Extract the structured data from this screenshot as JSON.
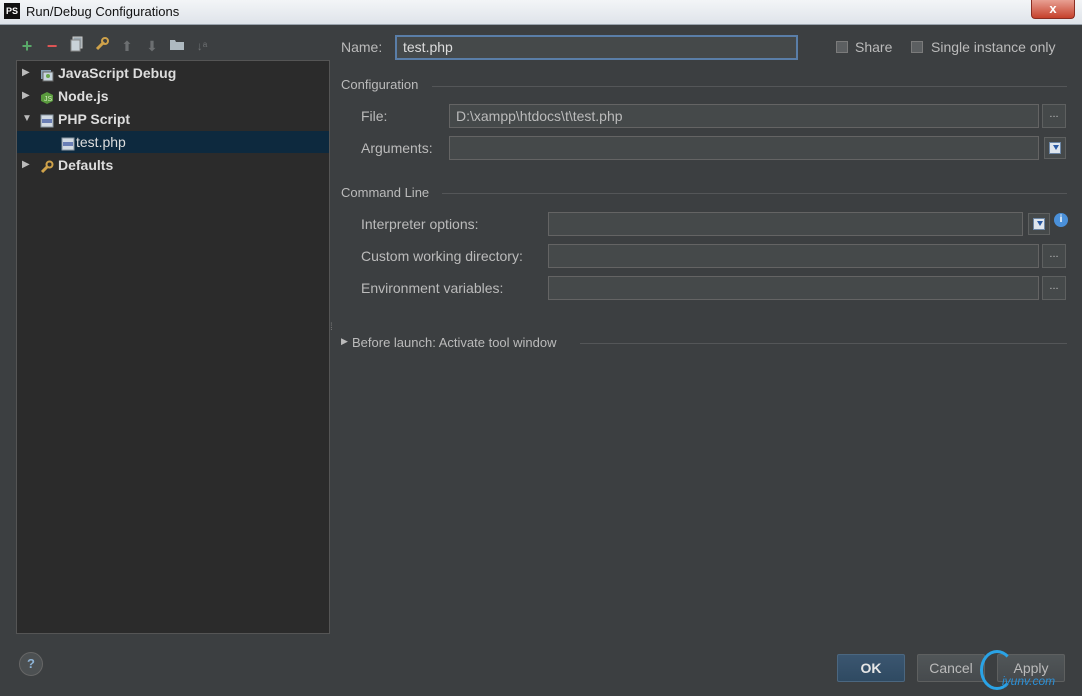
{
  "window": {
    "logo": "PS",
    "title": "Run/Debug Configurations",
    "close_glyph": "x"
  },
  "toolbar": {
    "icons": [
      "add-icon",
      "remove-icon",
      "copy-icon",
      "edit-defaults-icon",
      "move-up-icon",
      "move-down-icon",
      "folder-icon",
      "sort-icon"
    ]
  },
  "tree": {
    "items": [
      {
        "label": "JavaScript Debug",
        "expanded": false,
        "icon": "javascript-debug-icon"
      },
      {
        "label": "Node.js",
        "expanded": false,
        "icon": "nodejs-icon"
      },
      {
        "label": "PHP Script",
        "expanded": true,
        "icon": "php-script-icon"
      },
      {
        "label": "test.php",
        "selected": true,
        "icon": "php-file-icon"
      },
      {
        "label": "Defaults",
        "expanded": false,
        "icon": "wrench-icon"
      }
    ]
  },
  "form": {
    "name_label": "Name:",
    "name_value": "test.php",
    "share_label": "Share",
    "single_instance_label": "Single instance only",
    "configuration_section": "Configuration",
    "file_label": "File:",
    "file_value": "D:\\xampp\\htdocs\\t\\test.php",
    "arguments_label": "Arguments:",
    "arguments_value": "",
    "command_line_section": "Command Line",
    "interpreter_label": "Interpreter options:",
    "interpreter_value": "",
    "working_dir_label": "Custom working directory:",
    "working_dir_value": "",
    "env_label": "Environment variables:",
    "env_value": "",
    "before_launch": "Before launch: Activate tool window",
    "browse_glyph": "..."
  },
  "footer": {
    "help": "?",
    "ok": "OK",
    "cancel": "Cancel",
    "apply": "Apply"
  },
  "watermark": "iyunv.com"
}
